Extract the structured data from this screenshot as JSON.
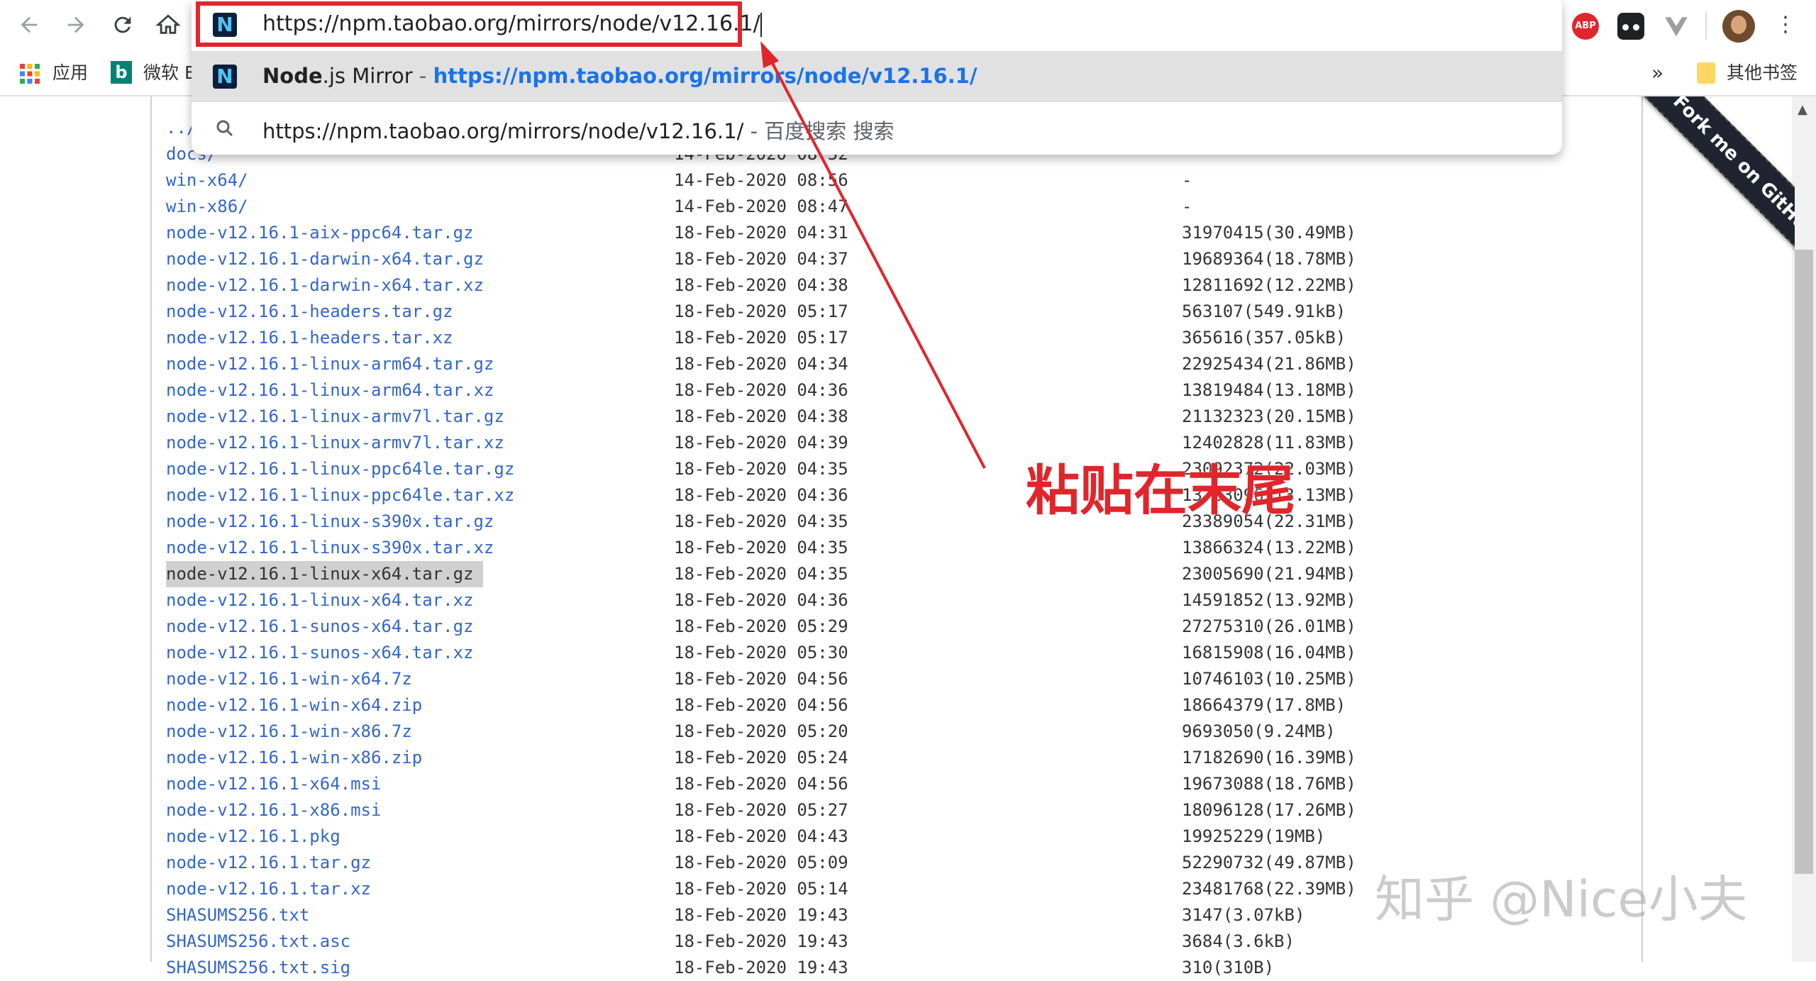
{
  "toolbar": {
    "url": "https://npm.taobao.org/mirrors/node/v12.16.1/"
  },
  "bookmarks": {
    "apps_label": "应用",
    "bing_label": "微软 E",
    "overflow": "»",
    "other_label": "其他书签"
  },
  "omnibox": {
    "suggestion1_title_bold": "Node",
    "suggestion1_title_rest": ".js Mirror",
    "suggestion1_sep": " - ",
    "suggestion1_url": "https://npm.taobao.org/mirrors/node/v12.16.1/",
    "suggestion2_text": "https://npm.taobao.org/mirrors/node/v12.16.1/",
    "suggestion2_suffix": " - 百度搜索 搜索"
  },
  "extensions": {
    "abp": "ABP"
  },
  "listing": {
    "rows": [
      {
        "name": "../",
        "date": "",
        "size": ""
      },
      {
        "name": "docs/",
        "date": "14-Feb-2020 08:52",
        "size": ""
      },
      {
        "name": "win-x64/",
        "date": "14-Feb-2020 08:56",
        "size": "-"
      },
      {
        "name": "win-x86/",
        "date": "14-Feb-2020 08:47",
        "size": "-"
      },
      {
        "name": "node-v12.16.1-aix-ppc64.tar.gz",
        "date": "18-Feb-2020 04:31",
        "size": "31970415(30.49MB)"
      },
      {
        "name": "node-v12.16.1-darwin-x64.tar.gz",
        "date": "18-Feb-2020 04:37",
        "size": "19689364(18.78MB)"
      },
      {
        "name": "node-v12.16.1-darwin-x64.tar.xz",
        "date": "18-Feb-2020 04:38",
        "size": "12811692(12.22MB)"
      },
      {
        "name": "node-v12.16.1-headers.tar.gz",
        "date": "18-Feb-2020 05:17",
        "size": "563107(549.91kB)"
      },
      {
        "name": "node-v12.16.1-headers.tar.xz",
        "date": "18-Feb-2020 05:17",
        "size": "365616(357.05kB)"
      },
      {
        "name": "node-v12.16.1-linux-arm64.tar.gz",
        "date": "18-Feb-2020 04:34",
        "size": "22925434(21.86MB)"
      },
      {
        "name": "node-v12.16.1-linux-arm64.tar.xz",
        "date": "18-Feb-2020 04:36",
        "size": "13819484(13.18MB)"
      },
      {
        "name": "node-v12.16.1-linux-armv7l.tar.gz",
        "date": "18-Feb-2020 04:38",
        "size": "21132323(20.15MB)"
      },
      {
        "name": "node-v12.16.1-linux-armv7l.tar.xz",
        "date": "18-Feb-2020 04:39",
        "size": "12402828(11.83MB)"
      },
      {
        "name": "node-v12.16.1-linux-ppc64le.tar.gz",
        "date": "18-Feb-2020 04:35",
        "size": "23092372(22.03MB)"
      },
      {
        "name": "node-v12.16.1-linux-ppc64le.tar.xz",
        "date": "18-Feb-2020 04:36",
        "size": "13763096(13.13MB)"
      },
      {
        "name": "node-v12.16.1-linux-s390x.tar.gz",
        "date": "18-Feb-2020 04:35",
        "size": "23389054(22.31MB)"
      },
      {
        "name": "node-v12.16.1-linux-s390x.tar.xz",
        "date": "18-Feb-2020 04:35",
        "size": "13866324(13.22MB)"
      },
      {
        "name": "node-v12.16.1-linux-x64.tar.gz",
        "date": "18-Feb-2020 04:35",
        "size": "23005690(21.94MB)"
      },
      {
        "name": "node-v12.16.1-linux-x64.tar.xz",
        "date": "18-Feb-2020 04:36",
        "size": "14591852(13.92MB)"
      },
      {
        "name": "node-v12.16.1-sunos-x64.tar.gz",
        "date": "18-Feb-2020 05:29",
        "size": "27275310(26.01MB)"
      },
      {
        "name": "node-v12.16.1-sunos-x64.tar.xz",
        "date": "18-Feb-2020 05:30",
        "size": "16815908(16.04MB)"
      },
      {
        "name": "node-v12.16.1-win-x64.7z",
        "date": "18-Feb-2020 04:56",
        "size": "10746103(10.25MB)"
      },
      {
        "name": "node-v12.16.1-win-x64.zip",
        "date": "18-Feb-2020 04:56",
        "size": "18664379(17.8MB)"
      },
      {
        "name": "node-v12.16.1-win-x86.7z",
        "date": "18-Feb-2020 05:20",
        "size": "9693050(9.24MB)"
      },
      {
        "name": "node-v12.16.1-win-x86.zip",
        "date": "18-Feb-2020 05:24",
        "size": "17182690(16.39MB)"
      },
      {
        "name": "node-v12.16.1-x64.msi",
        "date": "18-Feb-2020 04:56",
        "size": "19673088(18.76MB)"
      },
      {
        "name": "node-v12.16.1-x86.msi",
        "date": "18-Feb-2020 05:27",
        "size": "18096128(17.26MB)"
      },
      {
        "name": "node-v12.16.1.pkg",
        "date": "18-Feb-2020 04:43",
        "size": "19925229(19MB)"
      },
      {
        "name": "node-v12.16.1.tar.gz",
        "date": "18-Feb-2020 05:09",
        "size": "52290732(49.87MB)"
      },
      {
        "name": "node-v12.16.1.tar.xz",
        "date": "18-Feb-2020 05:14",
        "size": "23481768(22.39MB)"
      },
      {
        "name": "SHASUMS256.txt",
        "date": "18-Feb-2020 19:43",
        "size": "3147(3.07kB)"
      },
      {
        "name": "SHASUMS256.txt.asc",
        "date": "18-Feb-2020 19:43",
        "size": "3684(3.6kB)"
      },
      {
        "name": "SHASUMS256.txt.sig",
        "date": "18-Feb-2020 19:43",
        "size": "310(310B)"
      }
    ],
    "highlighted_row": 17
  },
  "ribbon": {
    "text": "Fork me on GitHub"
  },
  "annotation": {
    "text": "粘贴在末尾",
    "color": "#e0252c"
  },
  "watermark": {
    "text": "知乎 @Nice小夫"
  }
}
